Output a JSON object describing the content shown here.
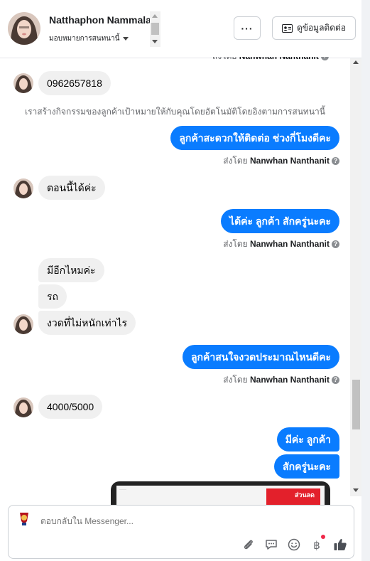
{
  "header": {
    "contact_name": "Natthaphon Nammala",
    "assign_label": "มอบหมายการสนทนานี้",
    "more_label": "···",
    "contact_info_label": "ดูข้อมูลติดต่อ"
  },
  "chat": {
    "top_cut_text": "ส่งโดย Nanwhan Nanthanit",
    "system_message": "เราสร้างกิจกรรมของลูกค้าเป้าหมายให้กับคุณโดยอัตโนมัติโดยอิงตามการสนทนานี้",
    "sent_prefix": "ส่งโดย",
    "agent_name": "Nanwhan Nanthanit",
    "messages": [
      {
        "dir": "in",
        "text": "0962657818"
      },
      {
        "dir": "out",
        "text": "ลูกค้าสะดวกให้ติดต่อ ช่วงกี่โมงดีคะ"
      },
      {
        "dir": "in",
        "text": "ตอนนี้ได้ค่ะ"
      },
      {
        "dir": "out",
        "text": "ได้ค่ะ ลูกค้า สักครู่นะคะ"
      },
      {
        "dir": "in",
        "text": "มีอีกไหมค่ะ"
      },
      {
        "dir": "in",
        "text": "รถ"
      },
      {
        "dir": "in",
        "text": "งวดที่ไม่หนักเท่าไร"
      },
      {
        "dir": "out",
        "text": "ลูกค้าสนใจงวดประมาณไหนดีคะ"
      },
      {
        "dir": "in",
        "text": "4000/5000"
      },
      {
        "dir": "out",
        "text": "มีค่ะ ลูกค้า"
      },
      {
        "dir": "out",
        "text": "สักครู่นะคะ"
      }
    ],
    "image_badge_text": "ส่วนลด"
  },
  "composer": {
    "placeholder": "ตอบกลับใน Messenger...",
    "icons": [
      "paperclip-icon",
      "quick-reply-icon",
      "emoji-icon",
      "baht-icon",
      "like-icon"
    ]
  },
  "colors": {
    "outgoing_bubble": "#0a7cff",
    "incoming_bubble": "#f0f0f0"
  }
}
